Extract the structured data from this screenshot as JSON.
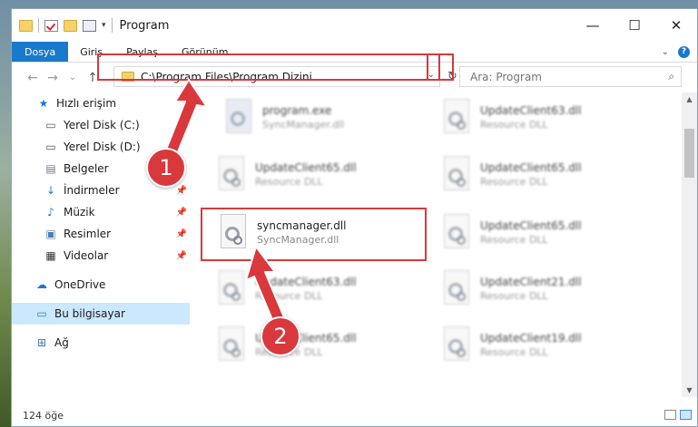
{
  "window": {
    "title": "Program",
    "controls": {
      "minimize": "—",
      "maximize": "☐",
      "close": "✕"
    }
  },
  "ribbon": {
    "tabs": [
      "Dosya",
      "Giriş",
      "Paylaş",
      "Görünüm"
    ],
    "active_tab": "Dosya",
    "accent": "#1979ca",
    "help_label": "?"
  },
  "navigation": {
    "back": "←",
    "forward": "→",
    "recent": "⌄",
    "up": "↑"
  },
  "address": {
    "path": "C:\\Program Files\\Program Dizini",
    "dropdown": "⌄",
    "refresh": "↻"
  },
  "search": {
    "placeholder": "Ara: Program",
    "icon": "⌕"
  },
  "sidebar": {
    "quick_access": "Hızlı erişim",
    "items": [
      {
        "label": "Yerel Disk (C:)",
        "icon": "drive-icon",
        "pinned": false
      },
      {
        "label": "Yerel Disk (D:)",
        "icon": "drive-icon",
        "pinned": false
      },
      {
        "label": "Belgeler",
        "icon": "documents-icon",
        "pinned": true
      },
      {
        "label": "İndirmeler",
        "icon": "downloads-icon",
        "pinned": true
      },
      {
        "label": "Müzik",
        "icon": "music-icon",
        "pinned": true
      },
      {
        "label": "Resimler",
        "icon": "pictures-icon",
        "pinned": true
      },
      {
        "label": "Videolar",
        "icon": "videos-icon",
        "pinned": true
      }
    ],
    "onedrive": "OneDrive",
    "this_pc": "Bu bilgisayar",
    "network": "Ağ"
  },
  "files": [
    {
      "name": "program.exe",
      "sub": "SyncManager.dll",
      "blurred": true
    },
    {
      "name": "UpdateClient63.dll",
      "sub": "Resource DLL",
      "blurred": true
    },
    {
      "name": "UpdateClient65.dll",
      "sub": "Resource DLL",
      "blurred": true
    },
    {
      "name": "UpdateClient65.dll",
      "sub": "Resource DLL",
      "blurred": true
    },
    {
      "name": "syncmanager.dll",
      "sub": "SyncManager.dll",
      "blurred": false
    },
    {
      "name": "UpdateClient65.dll",
      "sub": "Resource DLL",
      "blurred": true
    },
    {
      "name": "UpdateClient63.dll",
      "sub": "Resource DLL",
      "blurred": true
    },
    {
      "name": "UpdateClient21.dll",
      "sub": "Resource DLL",
      "blurred": true
    },
    {
      "name": "UpdateClient65.dll",
      "sub": "Resource DLL",
      "blurred": true
    },
    {
      "name": "UpdateClient19.dll",
      "sub": "Resource DLL",
      "blurred": true
    }
  ],
  "status": {
    "item_count": "124 öğe"
  },
  "annotations": {
    "step1": "1",
    "step2": "2",
    "highlight_color": "#d9383c"
  }
}
